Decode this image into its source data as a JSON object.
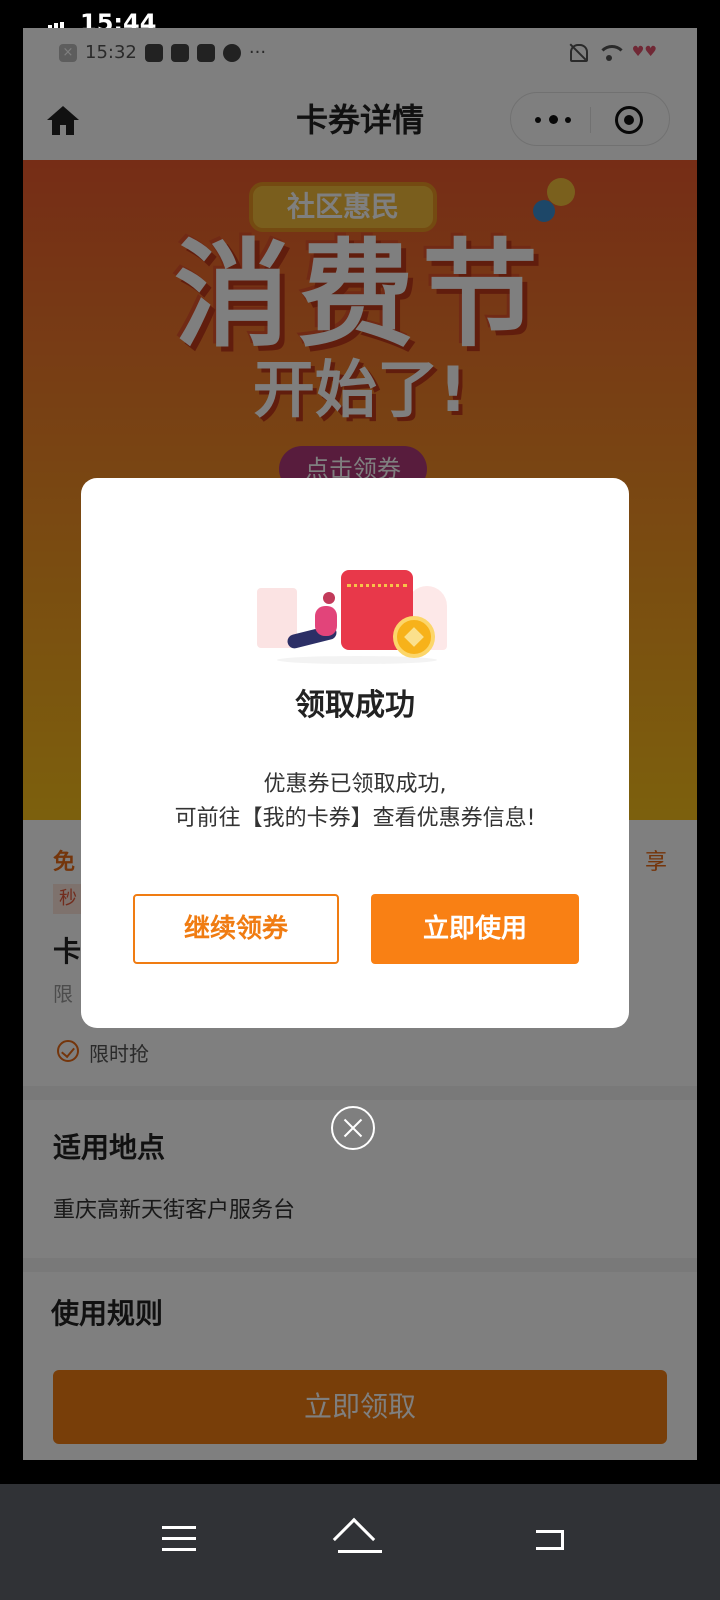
{
  "outer_status": {
    "time": "15:44"
  },
  "inner_status": {
    "time": "15:32",
    "battery_note": ""
  },
  "nav": {
    "title": "卡券详情"
  },
  "banner": {
    "badge": "社区惠民",
    "headline": "消费节",
    "subline": "开始了!",
    "button": "点击领券",
    "colors": {
      "top": "#ec5a2c",
      "bottom": "#f9c11a"
    }
  },
  "content": {
    "free_label": "免",
    "share_label": "享",
    "tag": "秒",
    "name": "卡",
    "limit": "限",
    "limited_time": "限时抢",
    "location_heading": "适用地点",
    "location": "重庆高新天街客户服务台",
    "rules_heading": "使用规则",
    "get_button": "立即领取"
  },
  "dialog": {
    "title": "领取成功",
    "message_line1": "优惠券已领取成功,",
    "message_line2": "可前往【我的卡券】查看优惠券信息!",
    "continue_button": "继续领券",
    "use_button": "立即使用",
    "accent_color": "#f07c12"
  }
}
